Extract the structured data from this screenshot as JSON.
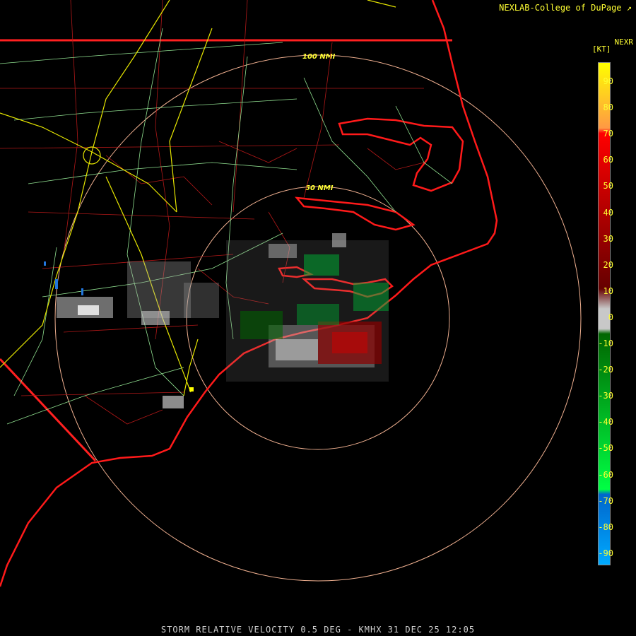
{
  "header": {
    "credit": "NEXLAB-College of DuPage",
    "product": "NEXR",
    "units": "[KT]"
  },
  "rings": {
    "outer_label": "100 NMI",
    "inner_label": "50 NMI"
  },
  "legend": {
    "ticks": [
      "90",
      "80",
      "70",
      "60",
      "50",
      "40",
      "30",
      "20",
      "10",
      "0",
      "-10",
      "-20",
      "-30",
      "-40",
      "-50",
      "-60",
      "-70",
      "-80",
      "-90"
    ],
    "colors": {
      "high": "#ffff00",
      "orange": "#ff9944",
      "red": "#ff0000",
      "darkred": "#660000",
      "gray": "#c8c8c8",
      "darkgreen": "#006600",
      "green": "#00ff44",
      "blue": "#0066cc",
      "cyan": "#00aaff"
    }
  },
  "footer": {
    "caption": "STORM RELATIVE VELOCITY 0.5 DEG - KMHX 31 DEC 25 12:05"
  }
}
